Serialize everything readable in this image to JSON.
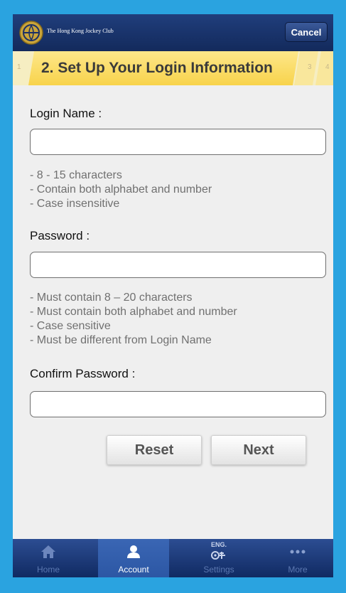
{
  "header": {
    "club_name": "The Hong Kong Jockey Club",
    "cancel_label": "Cancel"
  },
  "steps": {
    "step1": "1",
    "current_title": "2. Set Up Your Login Information",
    "step3": "3",
    "step4": "4"
  },
  "form": {
    "login_label": "Login Name :",
    "login_hints": [
      "- 8 - 15 characters",
      "- Contain both alphabet and number",
      "- Case insensitive"
    ],
    "password_label": "Password :",
    "password_hints": [
      "- Must contain 8 – 20 characters",
      "- Must contain both alphabet and number",
      "- Case sensitive",
      "- Must be different from Login Name"
    ],
    "confirm_label": "Confirm Password :",
    "login_value": "",
    "password_value": "",
    "confirm_value": ""
  },
  "buttons": {
    "reset": "Reset",
    "next": "Next"
  },
  "tabbar": {
    "home": "Home",
    "account": "Account",
    "settings": "Settings",
    "settings_badge": "ENG.",
    "more": "More",
    "active": "account"
  },
  "colors": {
    "header": "#1a3570",
    "step_active": "#f8d34b",
    "background_frame": "#2aa3e0"
  }
}
